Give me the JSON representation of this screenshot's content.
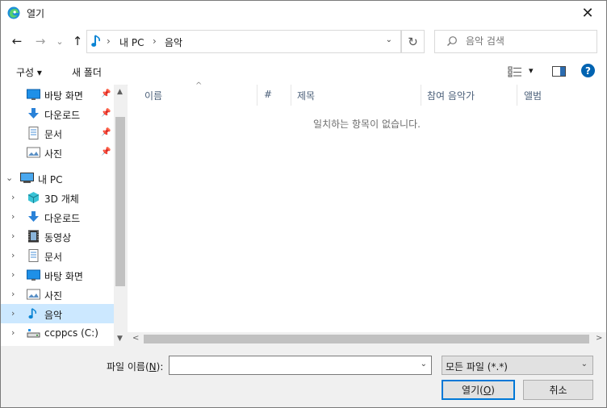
{
  "window": {
    "title": "열기",
    "close": "✕"
  },
  "nav": {
    "back": "←",
    "forward": "→",
    "recent": "⌄",
    "up": "↑",
    "address": {
      "crumbs": [
        "내 PC",
        "음악"
      ],
      "separator": "›",
      "dropdown": "⌄"
    },
    "refresh": "↻",
    "search": {
      "placeholder": "음악 검색",
      "value": ""
    }
  },
  "toolbar": {
    "organize": "구성 ▾",
    "new_folder": "새 폴더",
    "view_icon": "view-details-icon",
    "view_dropdown": "▾",
    "help": "?"
  },
  "sidebar": {
    "items": [
      {
        "label": "바탕 화면",
        "icon": "desktop-icon",
        "pinned": true
      },
      {
        "label": "다운로드",
        "icon": "download-icon",
        "pinned": true
      },
      {
        "label": "문서",
        "icon": "document-icon",
        "pinned": true
      },
      {
        "label": "사진",
        "icon": "picture-icon",
        "pinned": true
      },
      {
        "label": "내 PC",
        "icon": "computer-icon",
        "expander": "⌄"
      },
      {
        "label": "3D 개체",
        "icon": "cube-3d-icon",
        "expander": "›"
      },
      {
        "label": "다운로드",
        "icon": "download-icon",
        "expander": "›"
      },
      {
        "label": "동영상",
        "icon": "video-icon",
        "expander": "›"
      },
      {
        "label": "문서",
        "icon": "document-icon",
        "expander": "›"
      },
      {
        "label": "바탕 화면",
        "icon": "desktop-icon",
        "expander": "›"
      },
      {
        "label": "사진",
        "icon": "picture-icon",
        "expander": "›"
      },
      {
        "label": "음악",
        "icon": "music-icon",
        "expander": "›",
        "selected": true
      },
      {
        "label": "ccppcs (C:)",
        "icon": "drive-icon",
        "expander": "›"
      }
    ],
    "pin_glyph": "📌",
    "scroll_up": "▲",
    "scroll_down": "▼"
  },
  "files": {
    "columns": [
      "이름",
      "#",
      "제목",
      "참여 음악가",
      "앨범"
    ],
    "sort_caret": "^",
    "empty_message": "일치하는 항목이 없습니다.",
    "scroll_left": "<",
    "scroll_right": ">"
  },
  "bottom": {
    "filename_label_pre": "파일 이름(",
    "filename_label_key": "N",
    "filename_label_post": "):",
    "filename_value": "",
    "filetype": "모든 파일 (*.*)",
    "dropdown": "⌄",
    "open_pre": "열기(",
    "open_key": "O",
    "open_post": ")",
    "cancel": "취소"
  },
  "colors": {
    "selection": "#cce8ff",
    "accent": "#0078d7",
    "help": "#0063b1"
  }
}
